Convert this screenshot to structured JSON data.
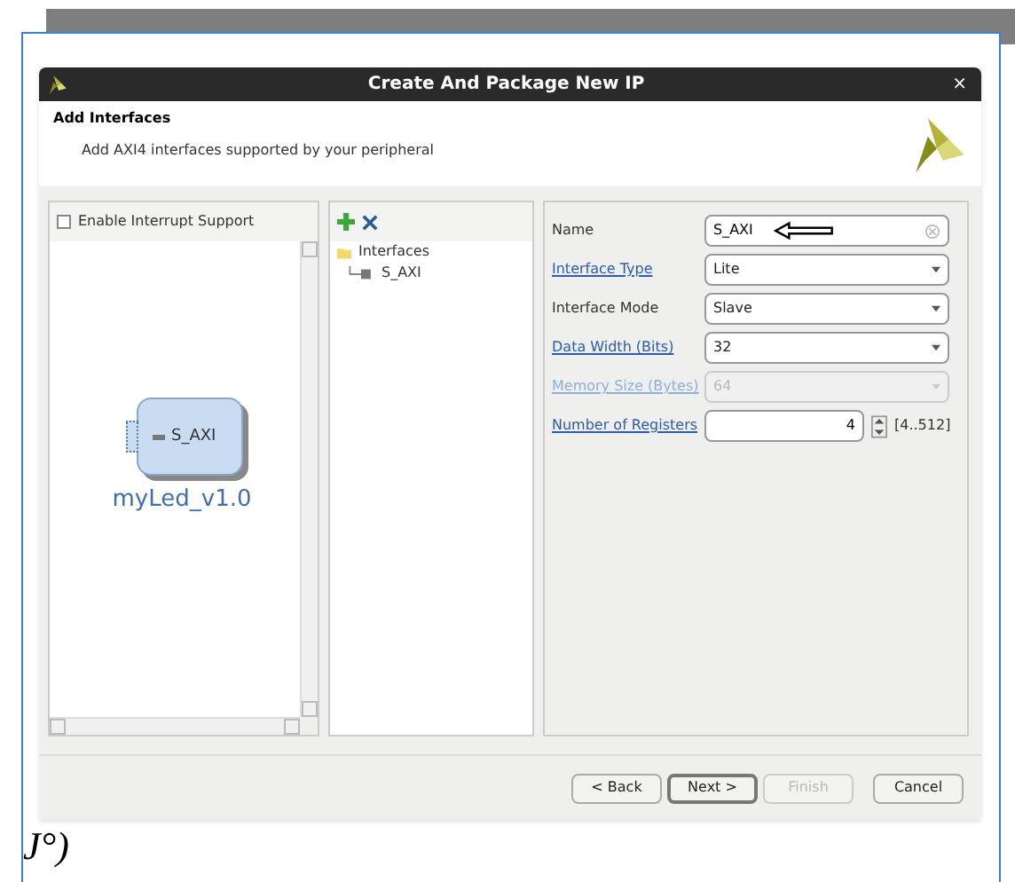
{
  "window": {
    "title": "Create And Package New IP",
    "close": "×"
  },
  "header": {
    "title": "Add Interfaces",
    "subtitle": "Add AXI4 interfaces supported by your peripheral"
  },
  "interrupt": {
    "label": "Enable Interrupt Support",
    "checked": false
  },
  "block": {
    "port": "S_AXI",
    "name": "myLed_v1.0"
  },
  "tree": {
    "label": "Interfaces",
    "expanded": true,
    "children": [
      {
        "label": "S_AXI",
        "selected": false
      }
    ]
  },
  "fields": [
    {
      "label": "Name",
      "link": false,
      "kind": "text",
      "value": "S_AXI",
      "disabled": false
    },
    {
      "label": "Interface Type",
      "link": true,
      "kind": "select",
      "value": "Lite",
      "disabled": false
    },
    {
      "label": "Interface Mode",
      "link": false,
      "kind": "select",
      "value": "Slave",
      "disabled": false
    },
    {
      "label": "Data Width (Bits)",
      "link": true,
      "kind": "select",
      "value": "32",
      "disabled": false
    },
    {
      "label": "Memory Size (Bytes)",
      "link": true,
      "kind": "select",
      "value": "64",
      "disabled": true
    },
    {
      "label": "Number of Registers",
      "link": true,
      "kind": "spin",
      "value": "4",
      "range": "[4..512]",
      "disabled": false
    }
  ],
  "buttons": [
    {
      "label": "< Back",
      "disabled": false,
      "default": false
    },
    {
      "label": "Next >",
      "disabled": false,
      "default": true
    },
    {
      "label": "Finish",
      "disabled": true,
      "default": false
    },
    {
      "label": "Cancel",
      "disabled": false,
      "default": false
    }
  ],
  "caption": "J°)"
}
